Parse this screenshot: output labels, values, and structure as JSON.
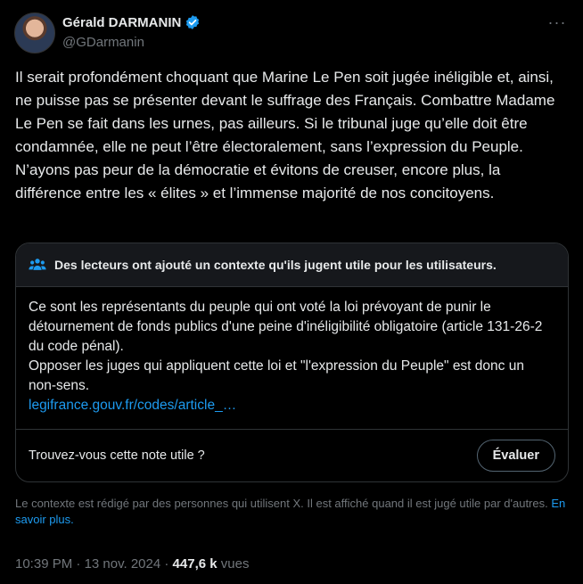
{
  "author": {
    "display_name": "Gérald DARMANIN",
    "handle": "@GDarmanin",
    "verified": true
  },
  "more_icon": "more-horizontal-icon",
  "tweet": {
    "text": "Il serait profondément choquant que Marine Le Pen soit jugée inéligible et, ainsi, ne puisse pas se présenter devant le suffrage des Français. Combattre Madame Le Pen se fait dans les urnes, pas ailleurs. Si le tribunal juge qu’elle doit être condamnée, elle ne peut l’être électoralement, sans l’expression du Peuple. N’ayons pas peur de la démocratie et évitons de creuser, encore plus, la différence entre les « élites » et l’immense majorité de nos concitoyens."
  },
  "community_note": {
    "header": "Des lecteurs ont ajouté un contexte qu'ils jugent utile pour les utilisateurs.",
    "icon": "people-icon",
    "body": "Ce sont les représentants du peuple qui ont voté la loi prévoyant de punir le détournement de fonds publics d'une peine d'inéligibilité obligatoire (article 131-26-2 du code pénal).\nOpposer les juges qui appliquent cette loi et \"l'expression du Peuple\" est donc un non-sens.",
    "link": "legifrance.gouv.fr/codes/article_…",
    "question": "Trouvez-vous cette note utile ?",
    "rate_button": "Évaluer"
  },
  "disclaimer": {
    "text": "Le contexte est rédigé par des personnes qui utilisent X. Il est affiché quand il est jugé utile par d'autres.",
    "link": "En savoir plus."
  },
  "meta": {
    "time": "10:39 PM",
    "date": "13 nov. 2024",
    "views_count": "447,6 k",
    "views_label": "vues"
  },
  "colors": {
    "background": "#000000",
    "accent": "#1d9bf0",
    "muted": "#71767b",
    "text": "#e7e9ea"
  }
}
